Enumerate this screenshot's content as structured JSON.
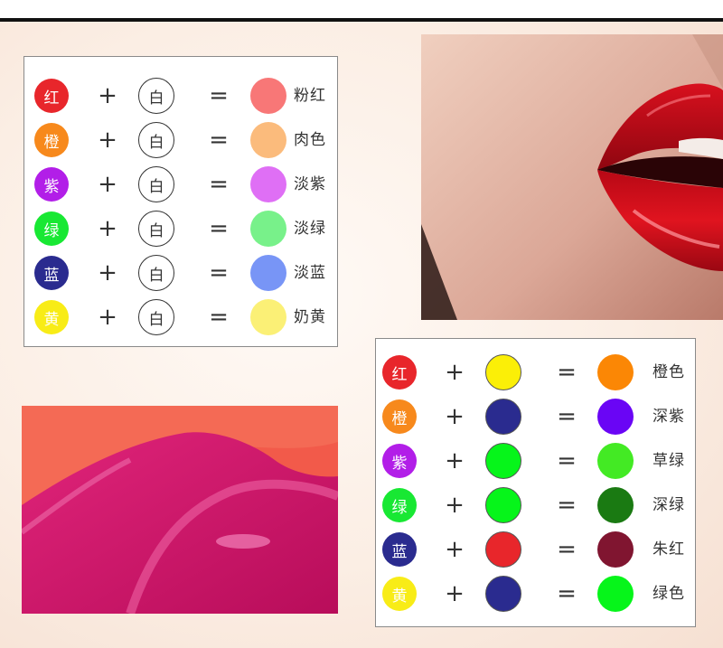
{
  "chart1": {
    "rows": [
      {
        "base": "红",
        "base_color": "#e8262b",
        "mid": "白",
        "result_color": "#f87777",
        "result": "粉红"
      },
      {
        "base": "橙",
        "base_color": "#f7891c",
        "mid": "白",
        "result_color": "#fbbb7c",
        "result": "肉色"
      },
      {
        "base": "紫",
        "base_color": "#b21ee8",
        "mid": "白",
        "result_color": "#df6ff5",
        "result": "淡紫"
      },
      {
        "base": "绿",
        "base_color": "#18e833",
        "mid": "白",
        "result_color": "#78f18a",
        "result": "淡绿"
      },
      {
        "base": "蓝",
        "base_color": "#2a2b8f",
        "mid": "白",
        "result_color": "#7895f6",
        "result": "淡蓝"
      },
      {
        "base": "黄",
        "base_color": "#f8ec17",
        "mid": "白",
        "result_color": "#fbf076",
        "result": "奶黄"
      }
    ]
  },
  "chart2": {
    "rows": [
      {
        "base": "红",
        "base_color": "#e8262b",
        "mid_color": "#fbef07",
        "result_color": "#fb8705",
        "result": "橙色"
      },
      {
        "base": "橙",
        "base_color": "#f7891c",
        "mid_color": "#2a2b8f",
        "result_color": "#6a05f5",
        "result": "深紫"
      },
      {
        "base": "紫",
        "base_color": "#b21ee8",
        "mid_color": "#06f51a",
        "result_color": "#43ea24",
        "result": "草绿"
      },
      {
        "base": "绿",
        "base_color": "#18e833",
        "mid_color": "#06f51a",
        "result_color": "#1a7a12",
        "result": "深绿"
      },
      {
        "base": "蓝",
        "base_color": "#2a2b8f",
        "mid_color": "#e8262b",
        "result_color": "#801530",
        "result": "朱红"
      },
      {
        "base": "黄",
        "base_color": "#f8ec17",
        "mid_color": "#2a2b8f",
        "result_color": "#06f51a",
        "result": "绿色"
      }
    ]
  },
  "symbols": {
    "plus": "+",
    "equals": "="
  }
}
